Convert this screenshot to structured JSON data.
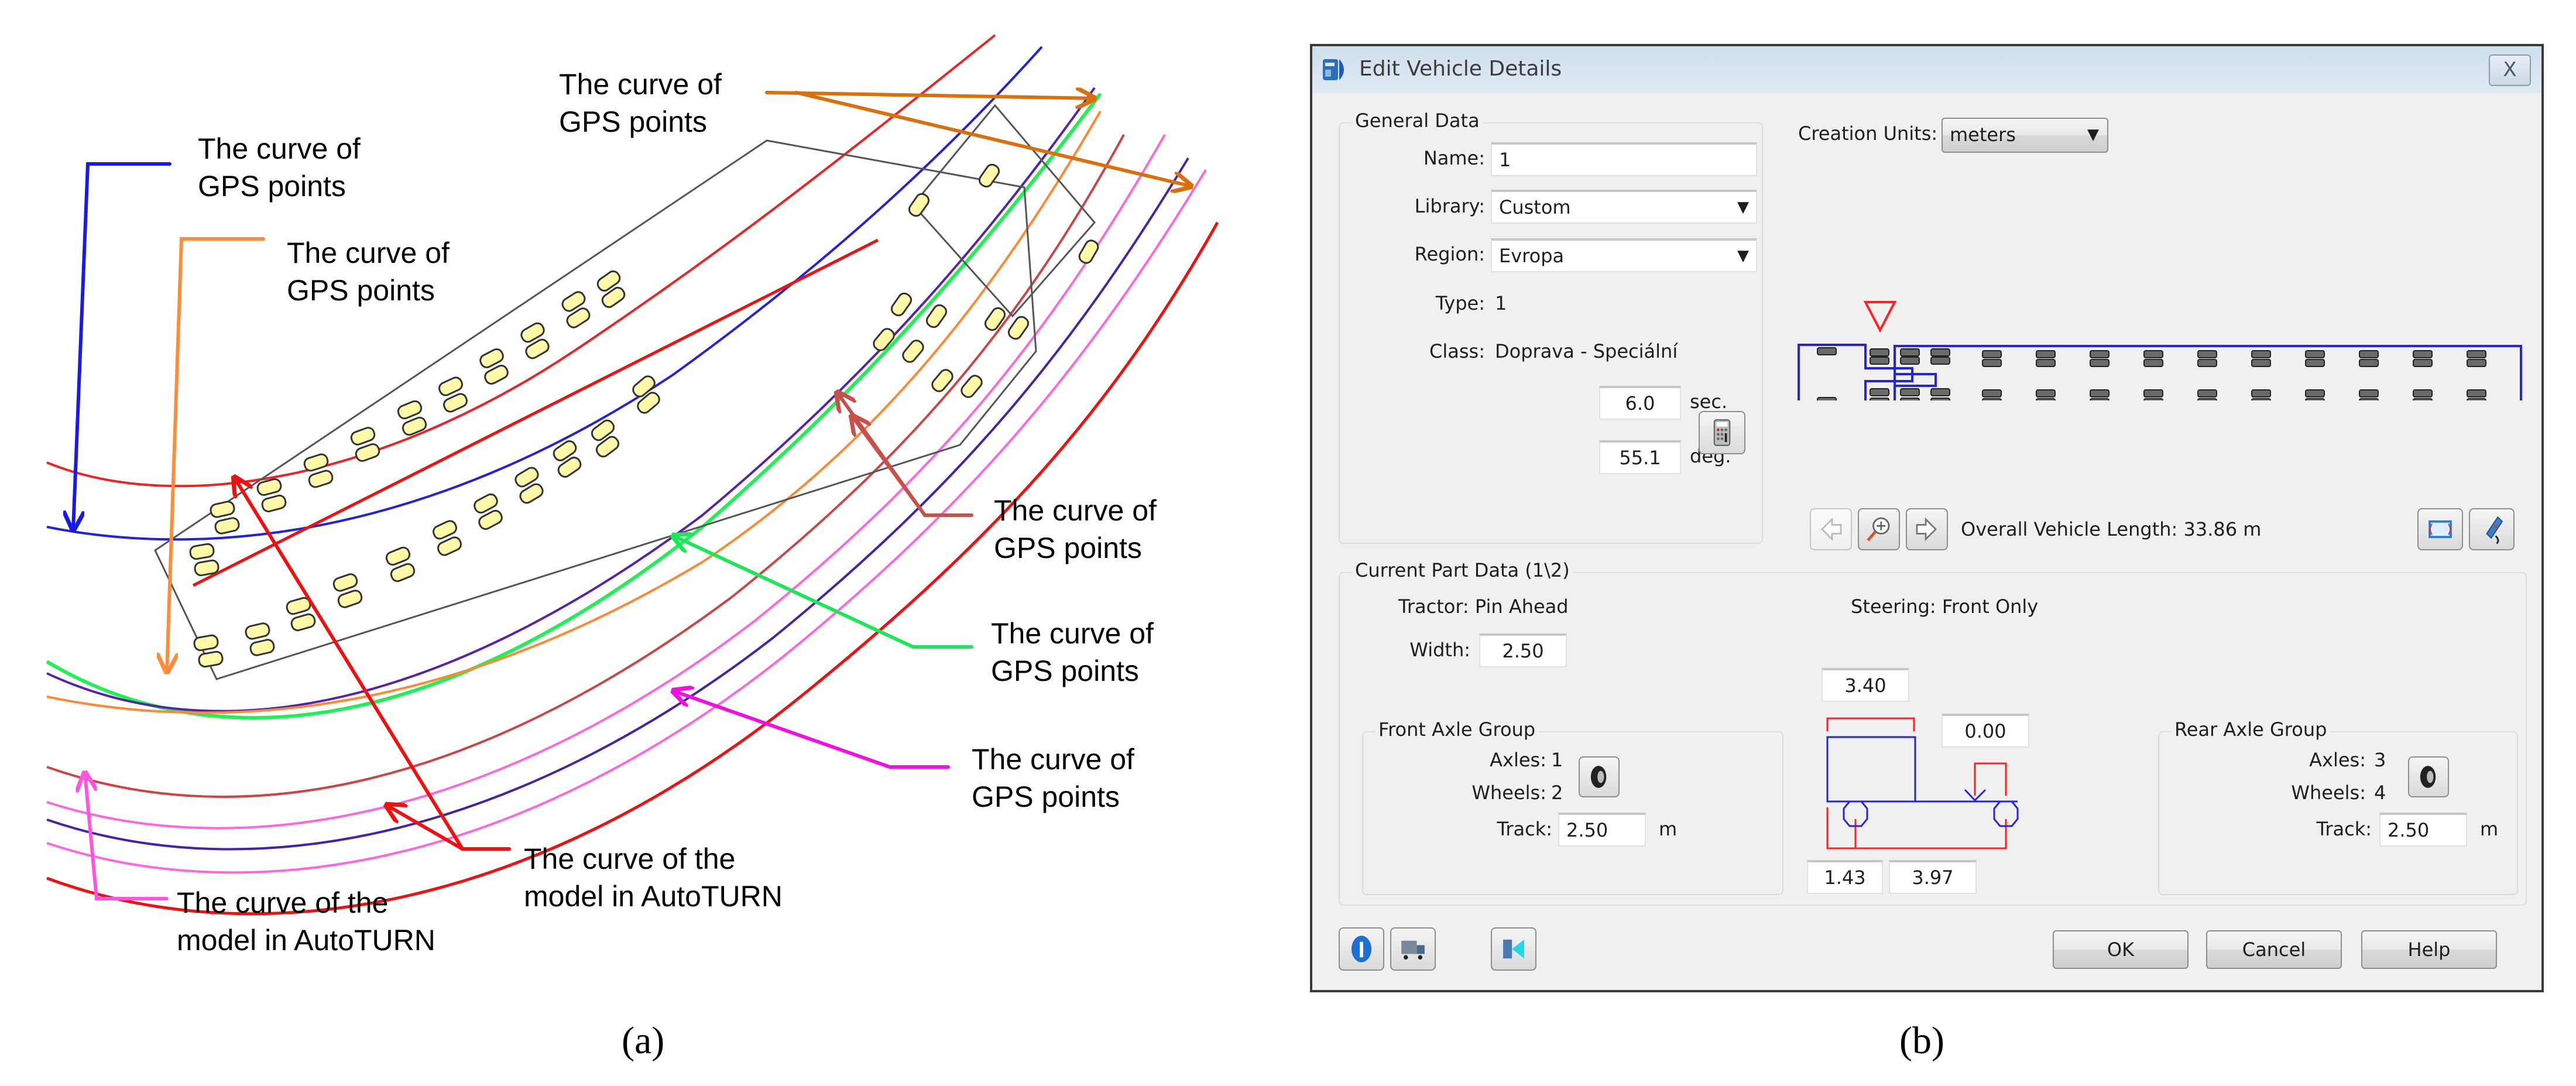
{
  "figure": {
    "caption_a": "(a)",
    "caption_b": "(b)",
    "annotations": [
      {
        "id": "blue",
        "text": "The curve of\nGPS points",
        "color": "#1a1ae6"
      },
      {
        "id": "orange-left",
        "text": "The curve of\nGPS points",
        "color": "#ff8c3a"
      },
      {
        "id": "orange-top",
        "text": "The curve of\nGPS points",
        "color": "#d9700d"
      },
      {
        "id": "darkred",
        "text": "The curve of\nGPS points",
        "color": "#c8504a"
      },
      {
        "id": "green",
        "text": "The curve of\nGPS points",
        "color": "#1ee65a"
      },
      {
        "id": "magenta",
        "text": "The curve of\nGPS points",
        "color": "#f010e0"
      },
      {
        "id": "red-model",
        "text": "The curve of the\nmodel in AutoTURN",
        "color": "#ee1111"
      },
      {
        "id": "pink-model",
        "text": "The curve of the\nmodel in AutoTURN",
        "color": "#ff55dd"
      }
    ]
  },
  "dialog": {
    "title": "Edit Vehicle Details",
    "close_label": "X",
    "general": {
      "legend": "General Data",
      "name_label": "Name:",
      "name_value": "1",
      "library_label": "Library:",
      "library_value": "Custom",
      "region_label": "Region:",
      "region_value": "Evropa",
      "type_label": "Type:",
      "type_value": "1",
      "class_label": "Class:",
      "class_value": "Doprava - Speciální",
      "time_value": "6.0",
      "time_unit": "sec.",
      "angle_value": "55.1",
      "angle_unit": "deg."
    },
    "creation_units_label": "Creation Units:",
    "creation_units_value": "meters",
    "overall_length_label": "Overall Vehicle Length:",
    "overall_length_value": "33.86 m",
    "part": {
      "legend": "Current Part Data (1\\2)",
      "tractor_label": "Tractor:",
      "tractor_value": "Pin Ahead",
      "steering_label": "Steering:",
      "steering_value": "Front Only",
      "width_label": "Width:",
      "width_value": "2.50",
      "dim_length": "3.40",
      "dim_offset": "0.00",
      "dim_front_overhang": "1.43",
      "dim_wheelbase": "3.97",
      "front_axle": {
        "legend": "Front Axle Group",
        "axles_label": "Axles:",
        "axles_value": "1",
        "wheels_label": "Wheels:",
        "wheels_value": "2",
        "track_label": "Track:",
        "track_value": "2.50",
        "track_unit": "m"
      },
      "rear_axle": {
        "legend": "Rear Axle Group",
        "axles_label": "Axles:",
        "axles_value": "3",
        "wheels_label": "Wheels:",
        "wheels_value": "4",
        "track_label": "Track:",
        "track_value": "2.50",
        "track_unit": "m"
      }
    },
    "buttons": {
      "ok": "OK",
      "cancel": "Cancel",
      "help": "Help"
    },
    "colors": {
      "vehicle_outline": "#2424d8",
      "dimension": "#ff2020"
    }
  }
}
